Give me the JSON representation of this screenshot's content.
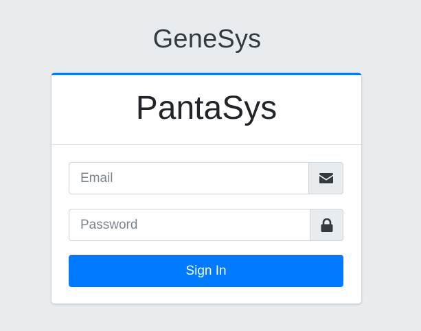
{
  "app": {
    "title": "GeneSys"
  },
  "card": {
    "title": "PantaSys"
  },
  "form": {
    "email_placeholder": "Email",
    "email_value": "",
    "email_icon": "envelope-icon",
    "password_placeholder": "Password",
    "password_value": "",
    "password_icon": "lock-icon",
    "submit_label": "Sign In"
  },
  "colors": {
    "page_background": "#e9ecef",
    "accent": "#007bff",
    "card_background": "#ffffff",
    "icon": "#343a40"
  }
}
